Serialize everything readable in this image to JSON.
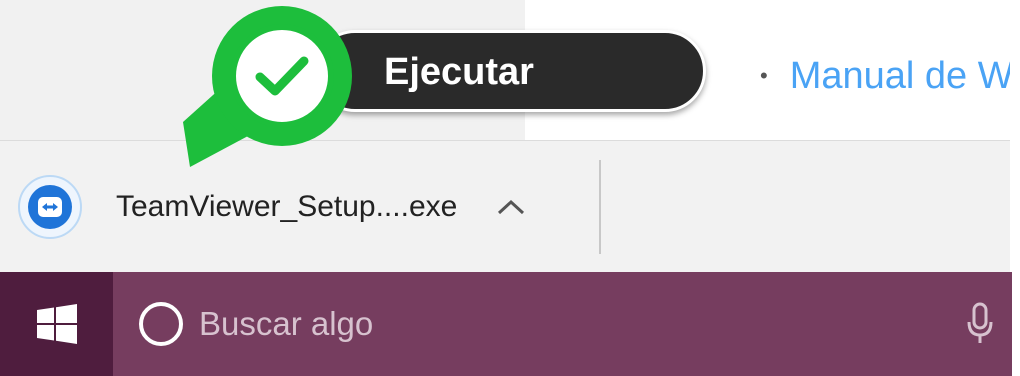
{
  "browser_page": {
    "link_text": "Manual de W"
  },
  "download_bar": {
    "file_name": "TeamViewer_Setup....exe",
    "icon": "teamviewer-icon",
    "expand_icon": "chevron-up-icon"
  },
  "callout": {
    "label": "Ejecutar",
    "icon": "checkmark-icon",
    "colors": {
      "accent": "#1dbe3c",
      "pill": "#2a2a2a"
    }
  },
  "taskbar": {
    "search_placeholder": "Buscar algo",
    "start_icon": "windows-logo-icon",
    "assistant_icon": "cortana-ring-icon",
    "mic_icon": "microphone-icon",
    "colors": {
      "bar": "#763d5f",
      "start": "#4f1d3e"
    }
  }
}
